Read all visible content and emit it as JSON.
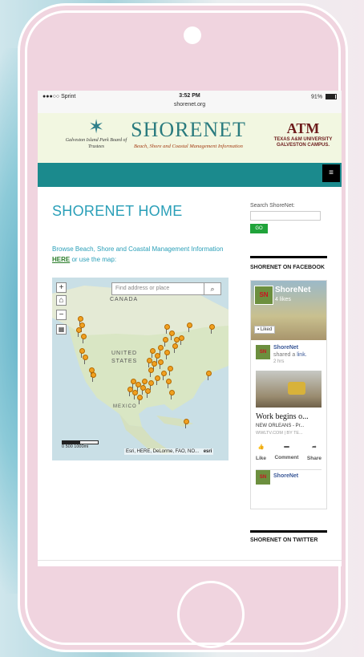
{
  "status_bar": {
    "carrier": "●●●○○ Sprint",
    "wifi_icon": "wifi-icon",
    "time": "3:52 PM",
    "url": "shorenet.org",
    "battery": "91%"
  },
  "header": {
    "left_logo_text": "Galveston Island Park Board of Trustees",
    "title": "SHORENET",
    "subtitle": "Beach, Shore and Coastal Management Information",
    "right_logo_mark": "ATM",
    "right_logo_text": "TEXAS A&M UNIVERSITY GALVESTON CAMPUS."
  },
  "nav": {
    "menu_icon": "≡"
  },
  "main": {
    "page_title": "SHORENET HOME",
    "intro_text": "Browse Beach, Shore and Coastal Management Information",
    "intro_link": "HERE",
    "intro_rest": " or use the map:"
  },
  "map": {
    "search_placeholder": "Find address or place",
    "zoom_in": "+",
    "home": "⌂",
    "zoom_out": "−",
    "label_canada": "CANADA",
    "label_us": "UNITED STATES",
    "label_mexico": "MEXICO",
    "scale": "0    500    1000mi",
    "attribution": "Esri, HERE, DeLorme, FAO, NO...",
    "esri_logo": "esri"
  },
  "sidebar": {
    "search_label": "Search ShoreNet:",
    "go_label": "GO",
    "facebook_title": "SHORENET ON FACEBOOK",
    "fb_page_name": "ShoreNet",
    "fb_likes": "4 likes",
    "fb_liked": "Liked",
    "fb_post_name": "ShoreNet",
    "fb_post_shared_prefix": "shared a ",
    "fb_post_shared_link": "link.",
    "fb_post_time": "2 hrs",
    "fb_headline": "Work begins o...",
    "fb_desc": "NEW ORLEANS - Pr...",
    "fb_source": "WWLTV.COM | BY TE...",
    "fb_like": "Like",
    "fb_comment": "Comment",
    "fb_share": "Share",
    "fb_next_name": "ShoreNet",
    "twitter_title": "SHORENET ON TWITTER"
  }
}
